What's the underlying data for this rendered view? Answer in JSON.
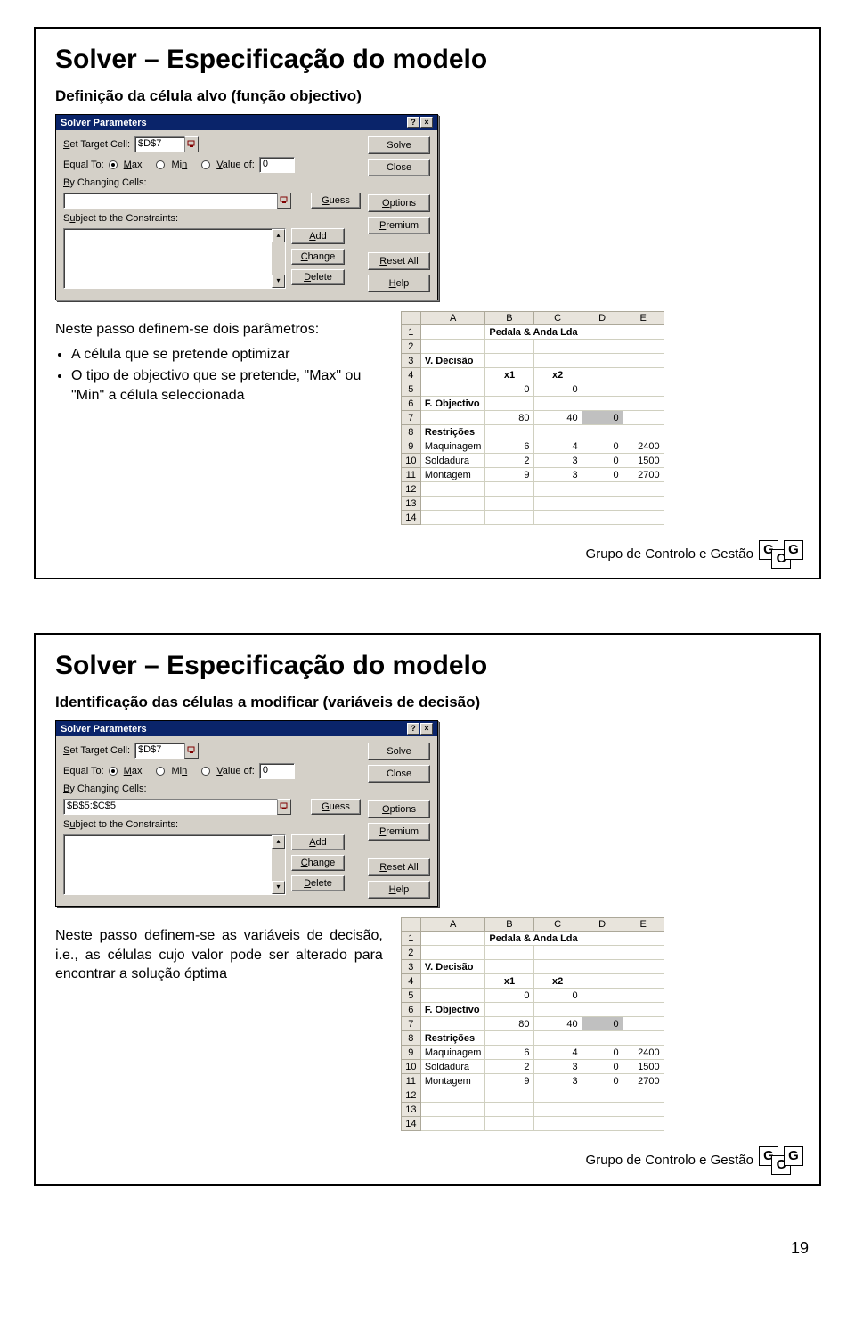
{
  "slide1": {
    "title": "Solver – Especificação do modelo",
    "subtitle": "Definição da célula alvo (função objectivo)",
    "intro": "Neste passo definem-se dois parâmetros:",
    "bullet1": "A célula que se pretende optimizar",
    "bullet2": "O tipo de objectivo que se pretende, \"Max\" ou \"Min\" a célula seleccionada"
  },
  "slide2": {
    "title": "Solver – Especificação do modelo",
    "subtitle": "Identificação das células a modificar (variáveis de decisão)",
    "intro": "Neste passo definem-se as variáveis de decisão, i.e., as células cujo valor pode ser alterado para encontrar a solução óptima"
  },
  "footer_label": "Grupo de Controlo e Gestão",
  "footer_g": "G",
  "footer_c": "C",
  "page_number": "19",
  "solver": {
    "title": "Solver Parameters",
    "set_target": "Set Target Cell:",
    "equal_to": "Equal To:",
    "max": "Max",
    "min": "Min",
    "value_of": "Value of:",
    "by_changing": "By Changing Cells:",
    "subject_to": "Subject to the Constraints:",
    "target_val": "$D$7",
    "value_val": "0",
    "changing_val2": "$B$5:$C$5",
    "btn_solve": "Solve",
    "btn_close": "Close",
    "btn_guess": "Guess",
    "btn_options": "Options",
    "btn_premium": "Premium",
    "btn_resetall": "Reset All",
    "btn_help": "Help",
    "btn_add": "Add",
    "btn_change": "Change",
    "btn_delete": "Delete",
    "help_q": "?",
    "close_x": "×"
  },
  "sheet": {
    "cols": [
      "",
      "A",
      "B",
      "C",
      "D",
      "E"
    ],
    "rows": [
      {
        "n": "1",
        "A": "",
        "B": "",
        "BC": "Pedala & Anda Lda",
        "D": "",
        "E": ""
      },
      {
        "n": "2",
        "A": "",
        "B": "",
        "C": "",
        "D": "",
        "E": ""
      },
      {
        "n": "3",
        "A": "V. Decisão",
        "B": "",
        "C": "",
        "D": "",
        "E": ""
      },
      {
        "n": "4",
        "A": "",
        "B": "x1",
        "C": "x2",
        "D": "",
        "E": ""
      },
      {
        "n": "5",
        "A": "",
        "B": "0",
        "C": "0",
        "D": "",
        "E": ""
      },
      {
        "n": "6",
        "A": "F. Objectivo",
        "B": "",
        "C": "",
        "D": "",
        "E": ""
      },
      {
        "n": "7",
        "A": "",
        "B": "80",
        "C": "40",
        "D": "0",
        "E": ""
      },
      {
        "n": "8",
        "A": "Restrições",
        "B": "",
        "C": "",
        "D": "",
        "E": ""
      },
      {
        "n": "9",
        "A": "Maquinagem",
        "B": "6",
        "C": "4",
        "D": "0",
        "E": "2400"
      },
      {
        "n": "10",
        "A": "Soldadura",
        "B": "2",
        "C": "3",
        "D": "0",
        "E": "1500"
      },
      {
        "n": "11",
        "A": "Montagem",
        "B": "9",
        "C": "3",
        "D": "0",
        "E": "2700"
      },
      {
        "n": "12",
        "A": "",
        "B": "",
        "C": "",
        "D": "",
        "E": ""
      },
      {
        "n": "13",
        "A": "",
        "B": "",
        "C": "",
        "D": "",
        "E": ""
      },
      {
        "n": "14",
        "A": "",
        "B": "",
        "C": "",
        "D": "",
        "E": ""
      }
    ]
  }
}
